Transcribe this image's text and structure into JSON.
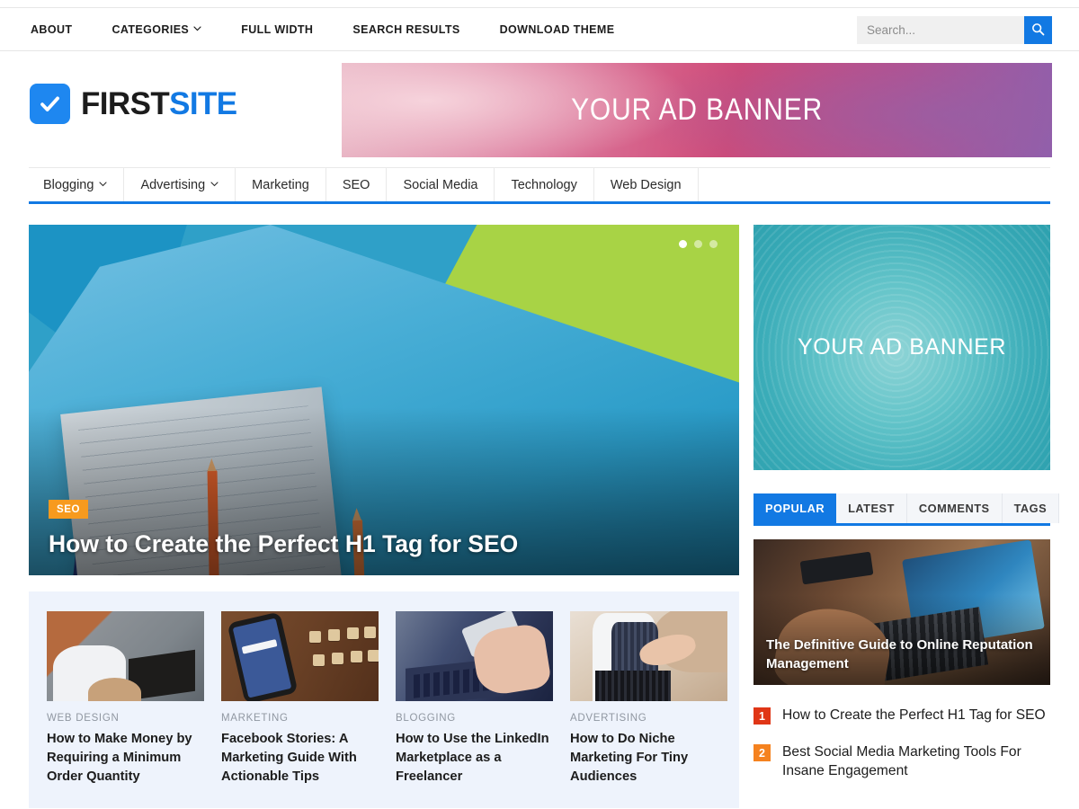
{
  "topbar": {
    "items": [
      {
        "label": "ABOUT",
        "has_caret": false
      },
      {
        "label": "CATEGORIES",
        "has_caret": true
      },
      {
        "label": "FULL WIDTH",
        "has_caret": false
      },
      {
        "label": "SEARCH RESULTS",
        "has_caret": false
      },
      {
        "label": "DOWNLOAD THEME",
        "has_caret": false
      }
    ],
    "search": {
      "placeholder": "Search...",
      "value": "",
      "button_icon": "search-icon"
    }
  },
  "header": {
    "logo": {
      "icon": "checkmark-icon",
      "text_first": "FIRST",
      "text_second": "SITE"
    },
    "ad_banner": {
      "text": "YOUR AD BANNER"
    }
  },
  "mainnav": {
    "items": [
      {
        "label": "Blogging",
        "has_caret": true
      },
      {
        "label": "Advertising",
        "has_caret": true
      },
      {
        "label": "Marketing",
        "has_caret": false
      },
      {
        "label": "SEO",
        "has_caret": false
      },
      {
        "label": "Social Media",
        "has_caret": false
      },
      {
        "label": "Technology",
        "has_caret": false
      },
      {
        "label": "Web Design",
        "has_caret": false
      }
    ]
  },
  "hero": {
    "category": "SEO",
    "title": "How to Create the Perfect H1 Tag for SEO",
    "slider_dots": 3,
    "active_dot": 1
  },
  "subposts": [
    {
      "category": "WEB DESIGN",
      "title": "How to Make Money by Requiring a Minimum Order Quantity"
    },
    {
      "category": "MARKETING",
      "title": "Facebook Stories: A Marketing Guide With Actionable Tips"
    },
    {
      "category": "BLOGGING",
      "title": "How to Use the LinkedIn Marketplace as a Freelancer"
    },
    {
      "category": "ADVERTISING",
      "title": "How to Do Niche Marketing For Tiny Audiences"
    }
  ],
  "sidebar": {
    "ad_banner": {
      "text": "YOUR AD BANNER"
    },
    "tabs": [
      {
        "label": "POPULAR",
        "active": true
      },
      {
        "label": "LATEST",
        "active": false
      },
      {
        "label": "COMMENTS",
        "active": false
      },
      {
        "label": "TAGS",
        "active": false
      }
    ],
    "featured": {
      "title": "The Definitive Guide to Online Reputation Management"
    },
    "popular": [
      {
        "rank": "1",
        "title": "How to Create the Perfect H1 Tag for SEO",
        "badge_color": "#e03616"
      },
      {
        "rank": "2",
        "title": "Best Social Media Marketing Tools For Insane Engagement",
        "badge_color": "#f5821f"
      }
    ]
  },
  "colors": {
    "accent_blue": "#1279e3",
    "badge_orange": "#f79a1e",
    "subgrid_bg": "#eef3fc"
  }
}
